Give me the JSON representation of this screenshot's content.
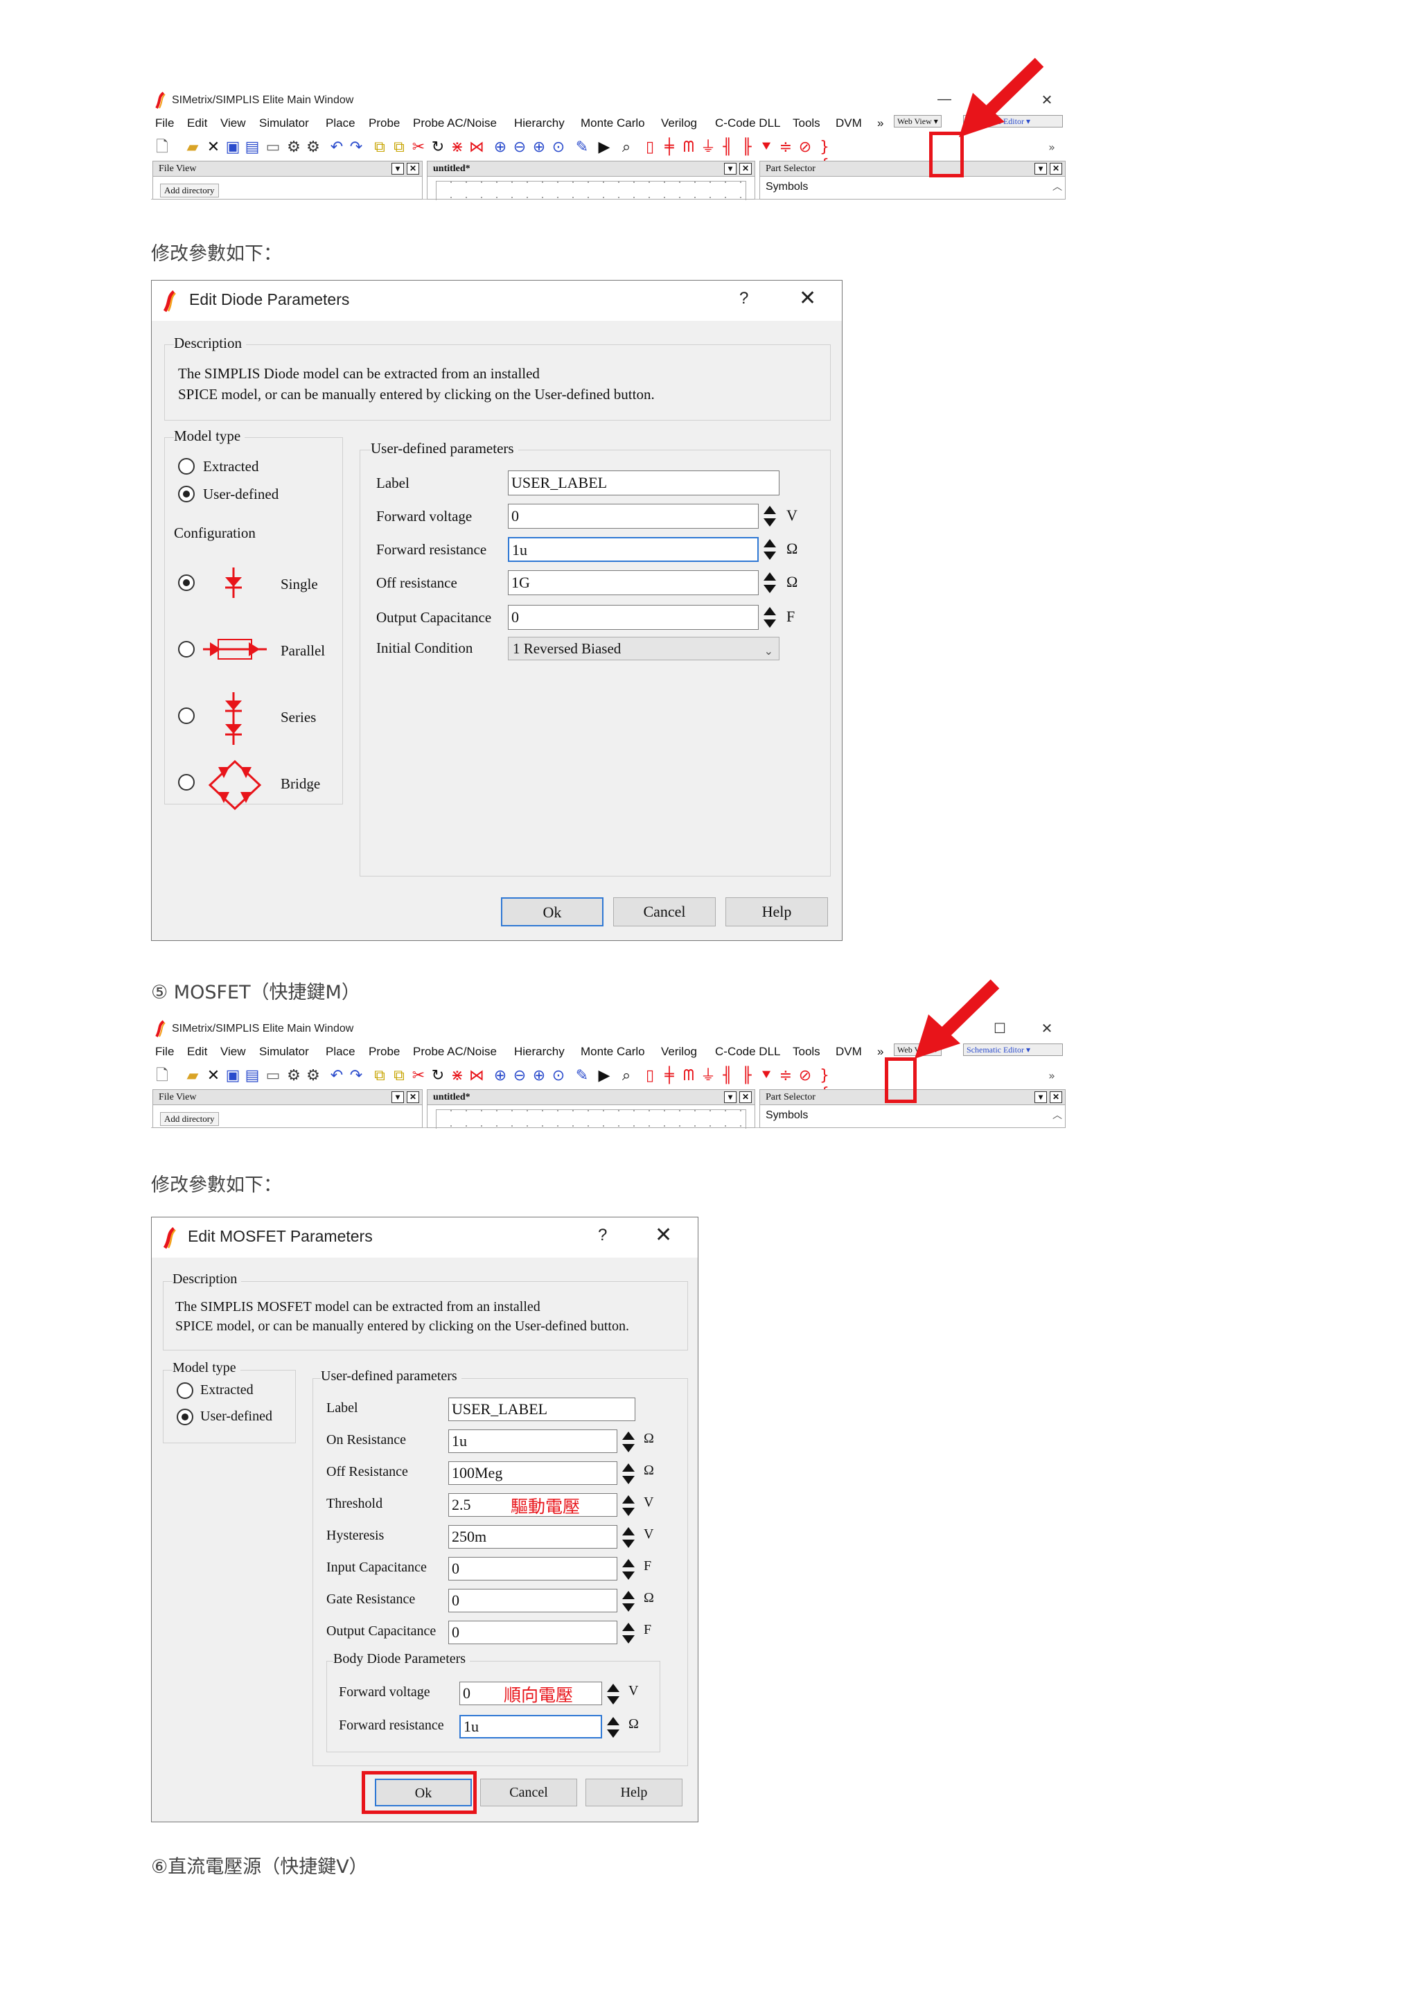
{
  "captions": {
    "modify1": "修改參數如下：",
    "mosfet_heading": "⑤ MOSFET（快捷鍵M）",
    "modify2": "修改參數如下：",
    "dc_source_heading": "⑥直流電壓源（快捷鍵V）"
  },
  "main_window": {
    "title": "SIMetrix/SIMPLIS Elite Main Window",
    "minimize": "—",
    "maximize": "☐",
    "close": "✕",
    "menu": [
      "File",
      "Edit",
      "View",
      "Simulator",
      "Place",
      "Probe",
      "Probe AC/Noise",
      "Hierarchy",
      "Monte Carlo",
      "Verilog",
      "C-Code DLL",
      "Tools",
      "DVM",
      "»"
    ],
    "web_view": "Web View",
    "schematic_editor": "Schematic Editor",
    "file_view": "File View",
    "add_directory": "Add directory",
    "schematic_tab": "untitled*",
    "part_selector": "Part Selector",
    "symbols": "Symbols"
  },
  "diode_dialog": {
    "title": "Edit Diode Parameters",
    "help_glyph": "?",
    "close_glyph": "✕",
    "description_label": "Description",
    "description_line1": "The SIMPLIS Diode model can be extracted from an installed",
    "description_line2": "SPICE model, or can be manually entered by clicking on the User-defined button.",
    "model_type_label": "Model type",
    "extracted": "Extracted",
    "user_defined": "User-defined",
    "configuration_label": "Configuration",
    "configs": [
      "Single",
      "Parallel",
      "Series",
      "Bridge"
    ],
    "params_label": "User-defined parameters",
    "rows": [
      {
        "label": "Label",
        "value": "USER_LABEL",
        "unit": ""
      },
      {
        "label": "Forward voltage",
        "value": "0",
        "unit": "V"
      },
      {
        "label": "Forward resistance",
        "value": "1u",
        "unit": "Ω"
      },
      {
        "label": "Off resistance",
        "value": "1G",
        "unit": "Ω"
      },
      {
        "label": "Output Capacitance",
        "value": "0",
        "unit": "F"
      }
    ],
    "initial_condition_label": "Initial Condition",
    "initial_condition_value": "1 Reversed Biased",
    "ok": "Ok",
    "cancel": "Cancel",
    "help": "Help"
  },
  "mosfet_dialog": {
    "title": "Edit MOSFET Parameters",
    "help_glyph": "?",
    "close_glyph": "✕",
    "description_label": "Description",
    "description_line1": "The SIMPLIS MOSFET model can be extracted from an installed",
    "description_line2": "SPICE model, or can be manually entered by clicking on the User-defined button.",
    "model_type_label": "Model type",
    "extracted": "Extracted",
    "user_defined": "User-defined",
    "params_label": "User-defined parameters",
    "rows": [
      {
        "label": "Label",
        "value": "USER_LABEL",
        "unit": ""
      },
      {
        "label": "On Resistance",
        "value": "1u",
        "unit": "Ω"
      },
      {
        "label": "Off Resistance",
        "value": "100Meg",
        "unit": "Ω"
      },
      {
        "label": "Threshold",
        "value": "2.5",
        "unit": "V"
      },
      {
        "label": "Hysteresis",
        "value": "250m",
        "unit": "V"
      },
      {
        "label": "Input Capacitance",
        "value": "0",
        "unit": "F"
      },
      {
        "label": "Gate Resistance",
        "value": "0",
        "unit": "Ω"
      },
      {
        "label": "Output Capacitance",
        "value": "0",
        "unit": "F"
      }
    ],
    "body_diode_label": "Body Diode Parameters",
    "body_rows": [
      {
        "label": "Forward voltage",
        "value": "0",
        "unit": "V"
      },
      {
        "label": "Forward resistance",
        "value": "1u",
        "unit": "Ω"
      }
    ],
    "note_threshold": "驅動電壓",
    "note_forward": "順向電壓",
    "ok": "Ok",
    "cancel": "Cancel",
    "help": "Help"
  },
  "colors": {
    "highlight": "#e8141a",
    "accent": "#2f78d4",
    "component": "#e8141a"
  }
}
